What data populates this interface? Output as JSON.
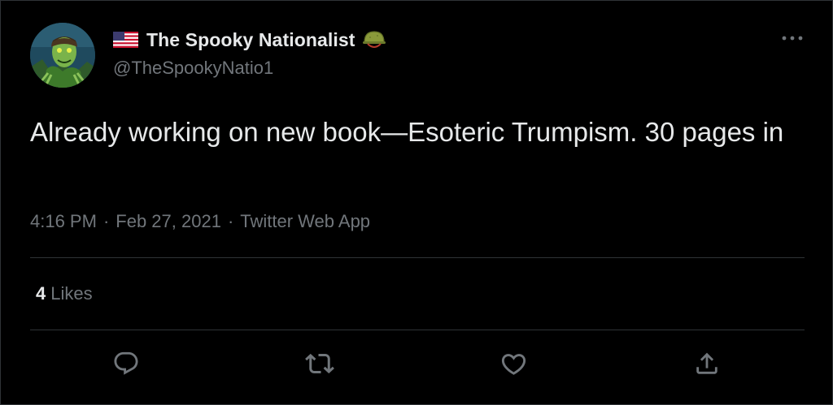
{
  "user": {
    "display_name": "The Spooky Nationalist",
    "handle": "@TheSpookyNatio1",
    "name_prefix_icon": "us-flag-icon",
    "name_suffix_icon": "military-helmet-icon"
  },
  "tweet": {
    "text": "Already working on new book—Esoteric Trumpism. 30 pages in",
    "time": "4:16 PM",
    "date": "Feb 27, 2021",
    "source": "Twitter Web App",
    "separator": "·"
  },
  "stats": {
    "likes_count": "4",
    "likes_label": "Likes"
  },
  "actions": [
    "reply-icon",
    "retweet-icon",
    "like-icon",
    "share-icon"
  ],
  "colors": {
    "background": "#000000",
    "text": "#e7e9ea",
    "secondary": "#71767b",
    "divider": "#2f3336"
  }
}
